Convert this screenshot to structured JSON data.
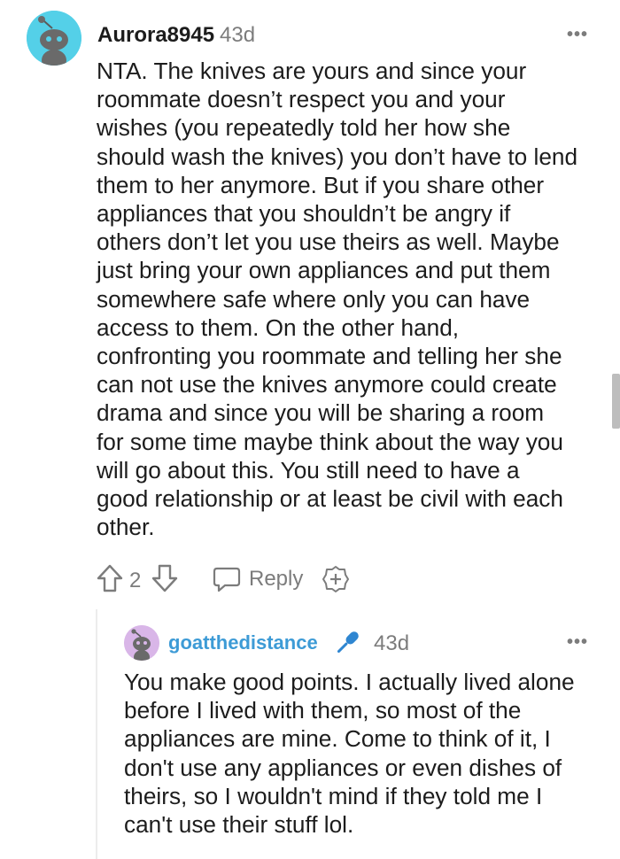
{
  "comment": {
    "username": "Aurora8945",
    "age": "43d",
    "more": "•••",
    "body": "NTA. The knives are yours and since your\nroommate doesn’t respect you and your\nwishes (you repeatedly told her how she\nshould wash the knives) you don’t have to lend\nthem to her anymore. But if you share other\nappliances that you shouldn’t be angry if\nothers don’t let you use theirs as well. Maybe\njust bring your own appliances and put them\nsomewhere safe where only you can have\naccess to them. On the other hand,\nconfronting you roommate and telling her she\ncan not use the knives anymore could create\ndrama and since you will be sharing a room\nfor some time maybe think about the way you\nwill go about this. You still need to have a\ngood relationship or at least be civil with each\nother.",
    "score": "2",
    "reply_label": "Reply",
    "avatar_color": "#54d0e8"
  },
  "reply": {
    "username": "goatthedistance",
    "badge_icon": "microphone-icon",
    "age": "43d",
    "more": "•••",
    "body": "You make good points. I actually lived alone\nbefore I lived with them, so most of the\nappliances are mine. Come to think of it, I\ndon't use any appliances or even dishes of\ntheirs, so I wouldn't mind if they told me I\ncan't use their stuff lol.",
    "avatar_color": "#d9b6e8",
    "username_color": "#3d9bd6"
  }
}
